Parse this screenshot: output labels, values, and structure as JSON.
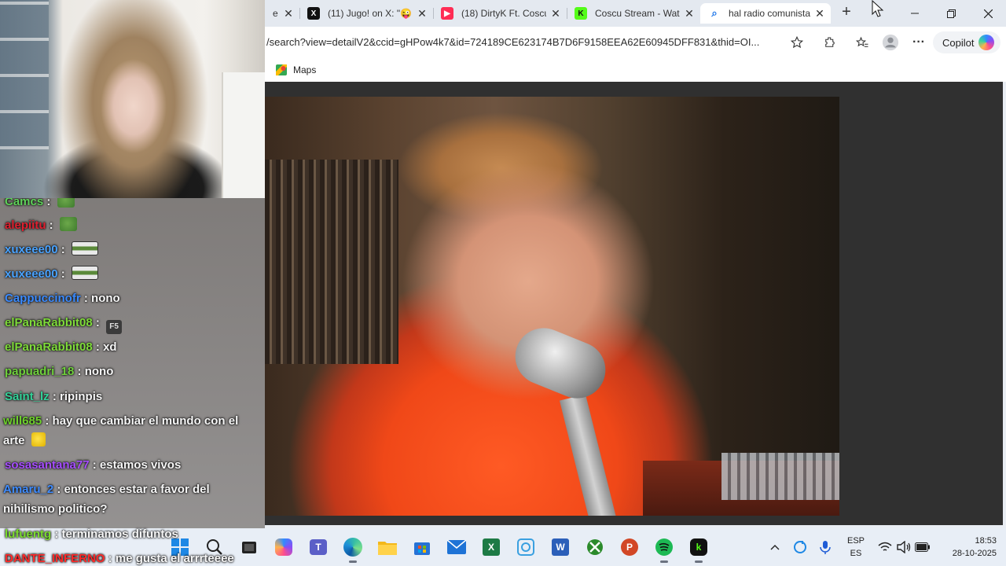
{
  "browser": {
    "tabs": [
      {
        "label": "e",
        "icon": "tab-partial-icon",
        "active": false
      },
      {
        "label": "(11) Jugo! on X: \"😜",
        "icon": "x-logo-icon",
        "active": false
      },
      {
        "label": "(18) DirtyK Ft. Coscu",
        "icon": "youtube-icon",
        "active": false
      },
      {
        "label": "Coscu Stream - Wat",
        "icon": "kick-icon",
        "active": false
      },
      {
        "label": "hal radio comunista",
        "icon": "bing-search-icon",
        "active": true
      }
    ],
    "address": "/search?view=detailV2&ccid=gHPow4k7&id=724189CE623174B7D6F9158EEA62E60945DFF831&thid=OI...",
    "copilot_label": "Copilot",
    "favorites": [
      {
        "label": "Maps",
        "icon": "maps-icon"
      }
    ]
  },
  "chat": {
    "messages": [
      {
        "user": "Camcs",
        "text": "",
        "color": "#5fd35a",
        "emote": "pepe"
      },
      {
        "user": "alepiitu",
        "text": "",
        "color": "#e0202f",
        "emote": "pepe"
      },
      {
        "user": "xuxeee00",
        "text": "",
        "color": "#4aa3ff",
        "emote": "flag"
      },
      {
        "user": "xuxeee00",
        "text": "",
        "color": "#4aa3ff",
        "emote": "flag"
      },
      {
        "user": "Cappuccinofr",
        "text": "nono",
        "color": "#3b8bff",
        "emote": ""
      },
      {
        "user": "elPanaRabbit08",
        "text": "",
        "color": "#7fdc3a",
        "emote": "f5"
      },
      {
        "user": "elPanaRabbit08",
        "text": "xd",
        "color": "#7fdc3a",
        "emote": ""
      },
      {
        "user": "papuadri_18",
        "text": "nono",
        "color": "#6fd13c",
        "emote": ""
      },
      {
        "user": "Saint_lz",
        "text": "ripinpis",
        "color": "#34d39a",
        "emote": ""
      },
      {
        "user": "will685",
        "text": "hay que cambiar el mundo con el arte",
        "color": "#6ed12d",
        "emote": "yellow"
      },
      {
        "user": "sosasantana77",
        "text": "estamos vivos",
        "color": "#a64dff",
        "emote": ""
      },
      {
        "user": "Amaru_2",
        "text": "entonces estar a favor del nihilismo politico?",
        "color": "#3f8cff",
        "emote": ""
      },
      {
        "user": "lufuentg",
        "text": "terminamos difuntos",
        "color": "#7bdc2f",
        "emote": ""
      },
      {
        "user": "DANTE_INFERNO",
        "text": "me gusta el arrrteeee",
        "color": "#ff2a2a",
        "emote": ""
      }
    ]
  },
  "taskbar": {
    "apps": [
      {
        "name": "windows-start-icon",
        "color": "#1e88e5"
      },
      {
        "name": "search-icon",
        "color": "#222"
      },
      {
        "name": "task-view-icon",
        "color": "#222"
      },
      {
        "name": "copilot-app-icon",
        "color": "#8a4cf5"
      },
      {
        "name": "teams-icon",
        "color": "#5b5fc7"
      },
      {
        "name": "edge-icon",
        "color": "#1d8fd8"
      },
      {
        "name": "file-explorer-icon",
        "color": "#f3b81b"
      },
      {
        "name": "store-icon",
        "color": "#2672d6"
      },
      {
        "name": "mail-icon",
        "color": "#1e73d6"
      },
      {
        "name": "excel-icon",
        "color": "#1d7a45"
      },
      {
        "name": "photos-icon",
        "color": "#3aa0e0"
      },
      {
        "name": "word-icon",
        "color": "#2b5fb9"
      },
      {
        "name": "xbox-icon",
        "color": "#2b8a2b"
      },
      {
        "name": "powerpoint-icon",
        "color": "#d24726"
      },
      {
        "name": "spotify-icon",
        "color": "#1db954"
      },
      {
        "name": "kick-app-icon",
        "color": "#111"
      }
    ],
    "lang_line1": "ESP",
    "lang_line2": "ES",
    "time": "18:53",
    "date": "28-10-2025"
  }
}
